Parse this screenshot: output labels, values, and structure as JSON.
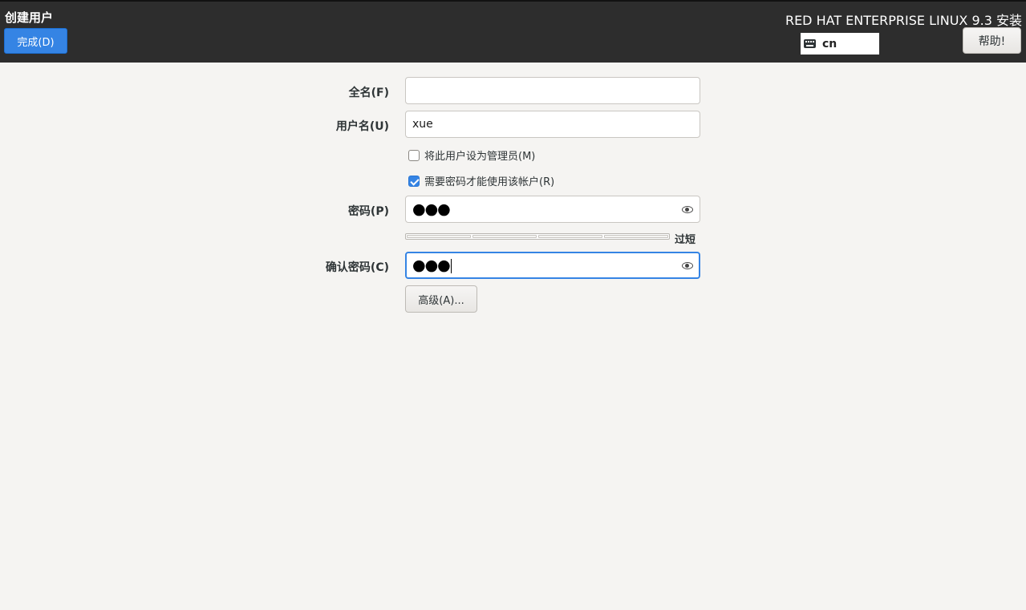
{
  "header": {
    "title": "创建用户",
    "done_button": "完成(D)",
    "product": "RED HAT ENTERPRISE LINUX 9.3 安装",
    "keyboard_layout": "cn",
    "help_button": "帮助!"
  },
  "form": {
    "fullname": {
      "label": "全名(F)",
      "value": ""
    },
    "username": {
      "label": "用户名(U)",
      "value": "xue"
    },
    "admin_checkbox": {
      "label": "将此用户设为管理员(M)",
      "checked": false
    },
    "require_password_checkbox": {
      "label": "需要密码才能使用该帐户(R)",
      "checked": true
    },
    "password": {
      "label": "密码(P)",
      "masked": "●●●"
    },
    "strength": {
      "text": "过短",
      "level": 0
    },
    "confirm": {
      "label": "确认密码(C)",
      "masked": "●●●"
    },
    "advanced_button": "高级(A)..."
  },
  "colors": {
    "accent": "#3584e4",
    "header_bg": "#2d2d2d",
    "page_bg": "#f5f4f2"
  }
}
